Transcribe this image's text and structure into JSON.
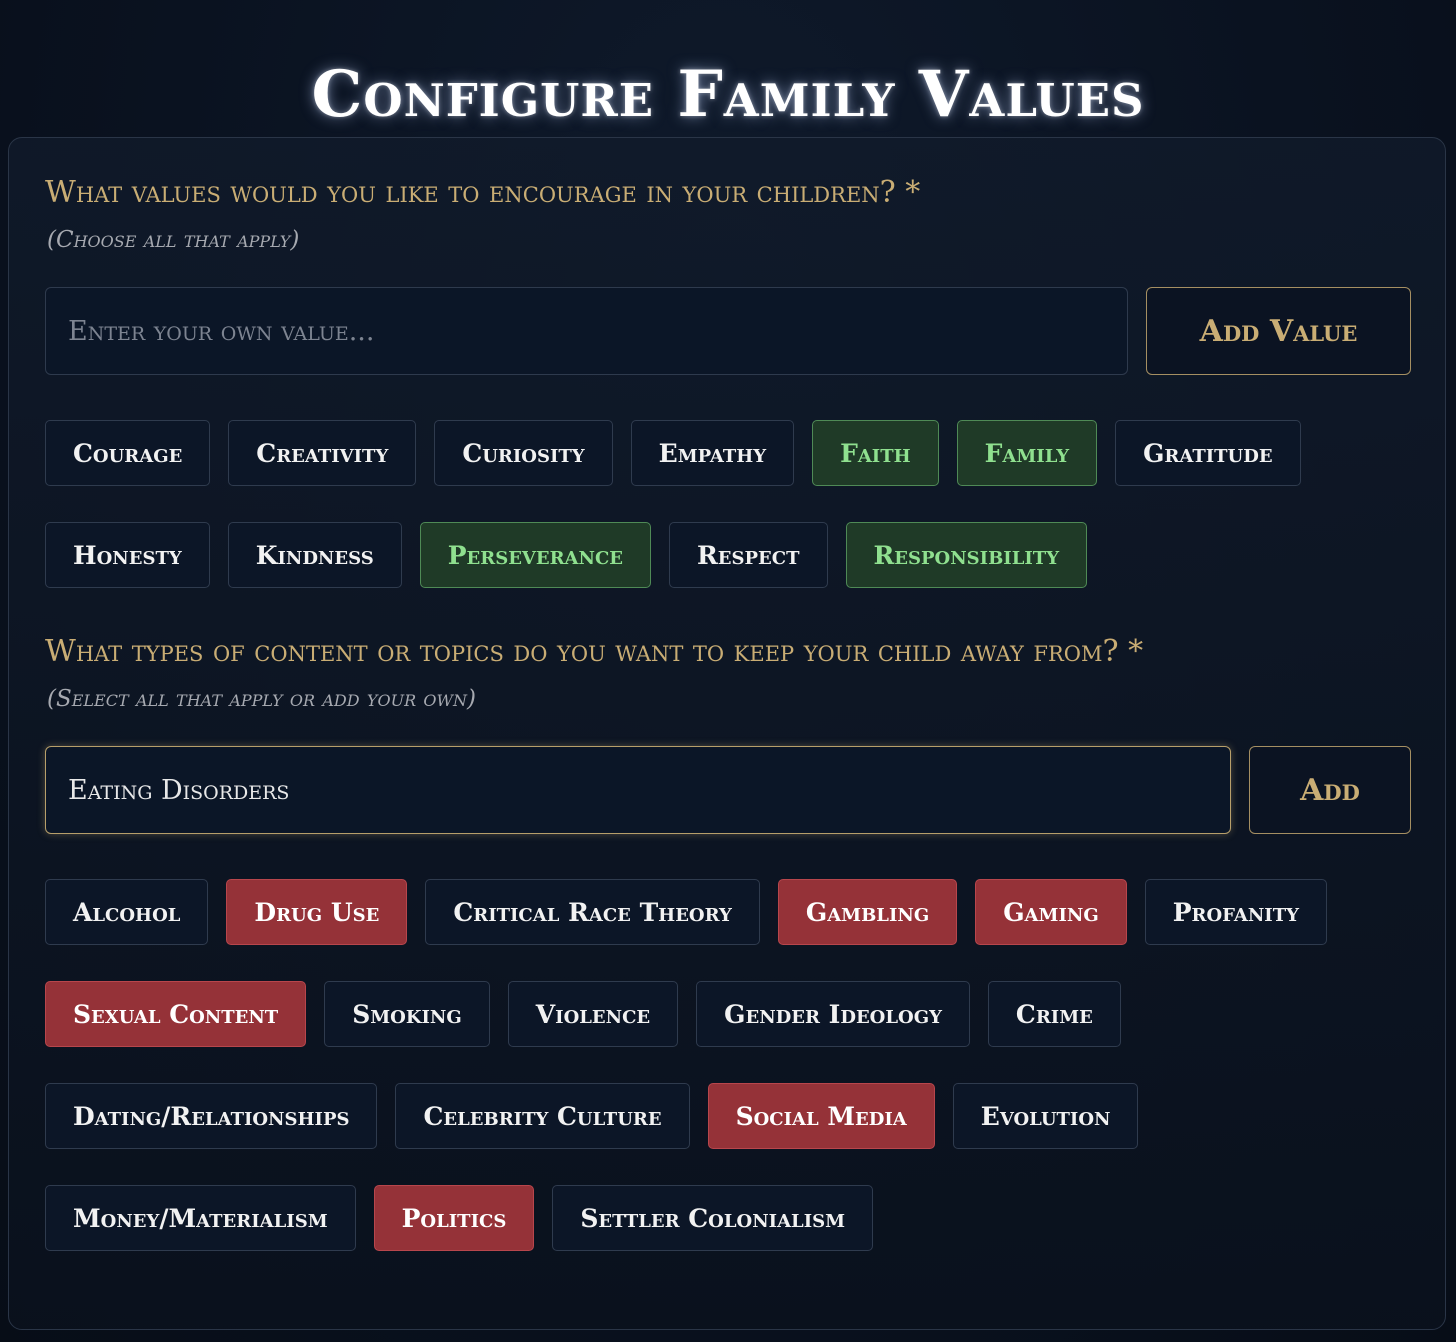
{
  "header": {
    "title": "Configure Family Values"
  },
  "values_section": {
    "question": "What values would you like to encourage in your children? *",
    "hint": "(Choose all that apply)",
    "input_placeholder": "Enter your own value...",
    "input_value": "",
    "add_button_label": "Add Value",
    "options": [
      {
        "label": "Courage",
        "selected": false
      },
      {
        "label": "Creativity",
        "selected": false
      },
      {
        "label": "Curiosity",
        "selected": false
      },
      {
        "label": "Empathy",
        "selected": false
      },
      {
        "label": "Faith",
        "selected": true
      },
      {
        "label": "Family",
        "selected": true
      },
      {
        "label": "Gratitude",
        "selected": false
      },
      {
        "label": "Honesty",
        "selected": false
      },
      {
        "label": "Kindness",
        "selected": false
      },
      {
        "label": "Perseverance",
        "selected": true
      },
      {
        "label": "Respect",
        "selected": false
      },
      {
        "label": "Responsibility",
        "selected": true
      }
    ]
  },
  "topics_section": {
    "question": "What types of content or topics do you want to keep your child away from? *",
    "hint": "(Select all that apply or add your own)",
    "input_placeholder": "",
    "input_value": "Eating Disorders",
    "add_button_label": "Add",
    "options": [
      {
        "label": "Alcohol",
        "selected": false
      },
      {
        "label": "Drug Use",
        "selected": true
      },
      {
        "label": "Critical Race Theory",
        "selected": false
      },
      {
        "label": "Gambling",
        "selected": true
      },
      {
        "label": "Gaming",
        "selected": true
      },
      {
        "label": "Profanity",
        "selected": false
      },
      {
        "label": "Sexual Content",
        "selected": true
      },
      {
        "label": "Smoking",
        "selected": false
      },
      {
        "label": "Violence",
        "selected": false
      },
      {
        "label": "Gender Ideology",
        "selected": false
      },
      {
        "label": "Crime",
        "selected": false
      },
      {
        "label": "Dating/Relationships",
        "selected": false
      },
      {
        "label": "Celebrity Culture",
        "selected": false
      },
      {
        "label": "Social Media",
        "selected": true
      },
      {
        "label": "Evolution",
        "selected": false
      },
      {
        "label": "Money/Materialism",
        "selected": false
      },
      {
        "label": "Politics",
        "selected": true
      },
      {
        "label": "Settler Colonialism",
        "selected": false
      }
    ]
  },
  "colors": {
    "accent_gold": "#c9ad74",
    "selected_value_bg": "#1f3a27",
    "selected_value_text": "#8fe08f",
    "selected_topic_bg": "#953238",
    "chip_bg": "#0c1627",
    "page_bg": "#0a1220"
  }
}
